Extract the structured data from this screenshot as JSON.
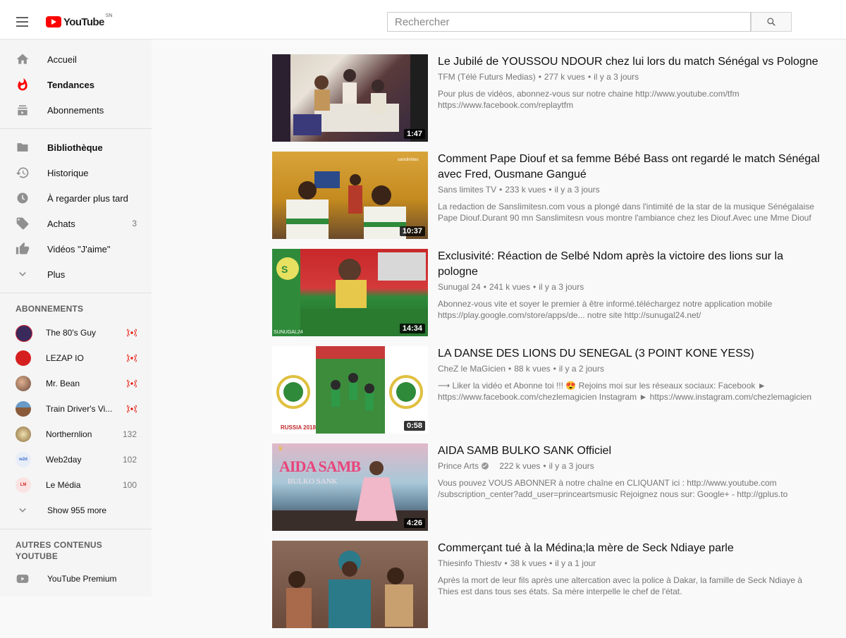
{
  "header": {
    "logo_text": "YouTube",
    "country_code": "SN",
    "search_placeholder": "Rechercher"
  },
  "sidebar": {
    "main": [
      {
        "label": "Accueil",
        "icon": "home-icon"
      },
      {
        "label": "Tendances",
        "icon": "trending-icon",
        "active": true
      },
      {
        "label": "Abonnements",
        "icon": "subscriptions-icon"
      }
    ],
    "library": [
      {
        "label": "Bibliothèque",
        "icon": "library-icon"
      },
      {
        "label": "Historique",
        "icon": "history-icon"
      },
      {
        "label": "À regarder plus tard",
        "icon": "watch-later-icon"
      },
      {
        "label": "Achats",
        "icon": "purchases-tag-icon",
        "count": "3"
      },
      {
        "label": "Vidéos \"J'aime\"",
        "icon": "thumbs-up-icon"
      },
      {
        "label": "Plus",
        "icon": "chevron-down-icon"
      }
    ],
    "subscriptions_title": "ABONNEMENTS",
    "subscriptions": [
      {
        "label": "The 80's Guy",
        "live": true,
        "avatar_color": "#3a2a5c"
      },
      {
        "label": "LEZAP IO",
        "live": true,
        "avatar_color": "#d61f1f"
      },
      {
        "label": "Mr. Bean",
        "live": true,
        "avatar_color": "#b57a5a"
      },
      {
        "label": "Train Driver's Vi...",
        "live": true,
        "avatar_color": "#8a5a3a"
      },
      {
        "label": "Northernlion",
        "count": "132",
        "avatar_color": "#c9b48a"
      },
      {
        "label": "Web2day",
        "count": "102",
        "avatar_color": "#e0e8f5"
      },
      {
        "label": "Le Média",
        "count": "100",
        "avatar_color": "#f2d4d4"
      }
    ],
    "show_more_label": "Show 955 more",
    "other_title": "AUTRES CONTENUS YOUTUBE",
    "other": [
      {
        "label": "YouTube Premium",
        "icon": "youtube-premium-icon"
      }
    ]
  },
  "videos": [
    {
      "title": "Le Jubilé de YOUSSOU NDOUR chez lui lors du match Sénégal vs Pologne",
      "channel": "TFM (Télé Futurs Medias)",
      "views": "277 k vues",
      "age": "il y a 3 jours",
      "description": "Pour plus de vidéos, abonnez-vous sur notre chaine http://www.youtube.com/tfm https://www.facebook.com/replaytfm",
      "duration": "1:47",
      "thumb_colors": [
        "#5a3c3a",
        "#c9b9a8",
        "#3a2e4a"
      ]
    },
    {
      "title": "Comment Pape Diouf et sa femme Bébé Bass ont regardé le match Sénégal avec Fred, Ousmane Gangué",
      "channel": "Sans limites TV",
      "views": "233 k vues",
      "age": "il y a 3 jours",
      "description": "La redaction de Sanslimitesn.com vous a plongé dans l'intimité de la star de la musique Sénégalaise Pape Diouf.Durant 90 mn Sanslimitesn vous montre l'ambiance chez les Diouf.Avec une Mme Diouf tr...",
      "duration": "10:37",
      "thumb_colors": [
        "#c9941f",
        "#e8e8e0",
        "#3a6a2a"
      ]
    },
    {
      "title": "Exclusivité: Réaction de Selbé Ndom après la victoire des lions sur la pologne",
      "channel": "Sunugal 24",
      "views": "241 k vues",
      "age": "il y a 3 jours",
      "description": "Abonnez-vous vite et soyer le premier à être informé.téléchargez notre application mobile https://play.google.com/store/apps/de... notre site http://sunugal24.net/",
      "duration": "14:34",
      "thumb_colors": [
        "#c0282a",
        "#2f8a3a",
        "#e8d74a"
      ]
    },
    {
      "title": "LA DANSE DES LIONS DU SENEGAL (3 POINT KONE YESS)",
      "channel": "CheZ le MaGicien",
      "views": "88 k vues",
      "age": "il y a 2 jours",
      "description": "⟶ Liker la vidéo et Abonne toi !!! 😍 Rejoins moi sur les réseaux sociaux: Facebook ► https://www.facebook.com/chezlemagicien Instagram ► https://www.instagram.com/chezlemagicien",
      "duration": "0:58",
      "thumb_colors": [
        "#ffffff",
        "#3c8c3c",
        "#d8c24a"
      ]
    },
    {
      "title": "AIDA SAMB BULKO SANK Officiel",
      "channel": "Prince Arts",
      "verified": true,
      "views": "222 k vues",
      "age": "il y a 3 jours",
      "description": "Vous pouvez VOUS ABONNER à notre chaîne en CLIQUANT ici : http://www.youtube.com /subscription_center?add_user=princeartsmusic Rejoignez nous sur: Google+ - http://gplus.to",
      "duration": "4:26",
      "thumb_overlay_title": "AIDA SAMB",
      "thumb_overlay_sub": "BULKO SANK",
      "thumb_colors": [
        "#8ab8c8",
        "#e3a8b8",
        "#3a2a2a"
      ]
    },
    {
      "title": "Commerçant tué à la Médina;la mère de Seck Ndiaye parle",
      "channel": "Thiesinfo Thiestv",
      "views": "38 k vues",
      "age": "il y a 1 jour",
      "description": "Après la mort de leur fils après une altercation avec la police à Dakar, la famille de Seck Ndiaye à Thies est dans tous ses états. Sa mère interpelle le chef de l'état.",
      "duration": "",
      "thumb_colors": [
        "#6a4a3a",
        "#2a7a8a",
        "#c8a070"
      ]
    }
  ]
}
